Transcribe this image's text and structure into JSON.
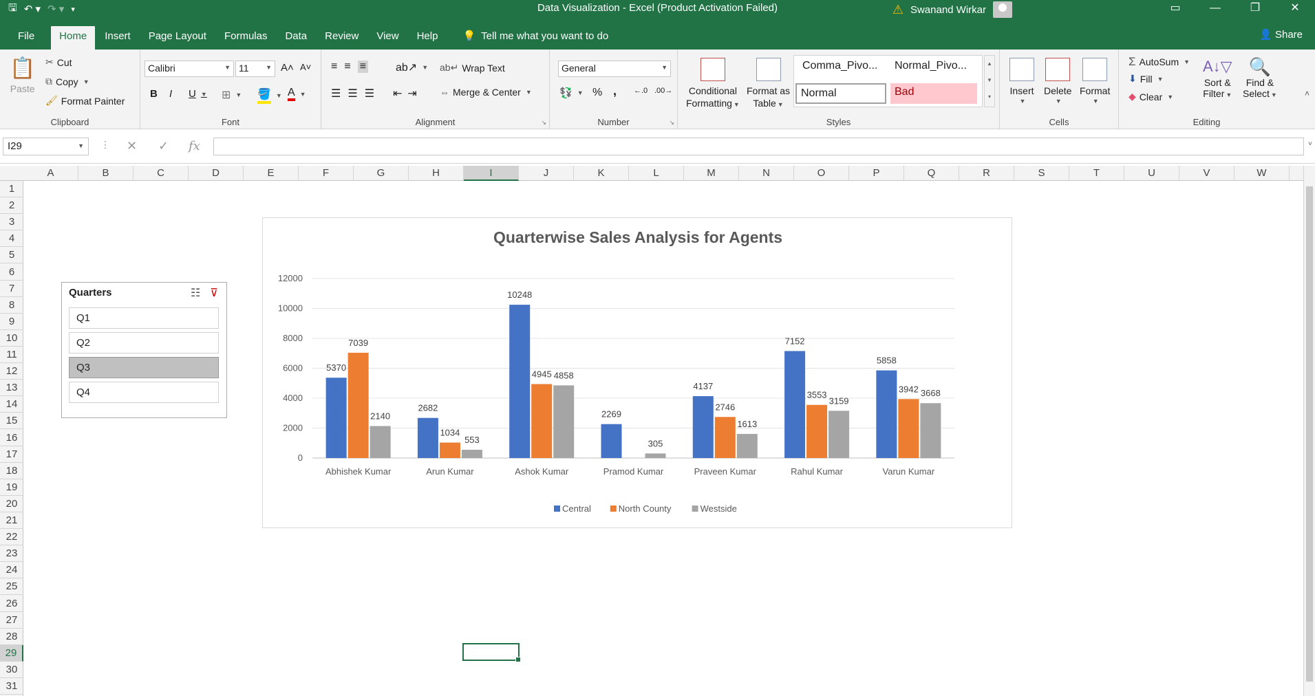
{
  "window": {
    "title": "Data Visualization  -  Excel (Product Activation Failed)",
    "user": "Swanand Wirkar"
  },
  "tabs": {
    "file": "File",
    "home": "Home",
    "insert": "Insert",
    "page_layout": "Page Layout",
    "formulas": "Formulas",
    "data": "Data",
    "review": "Review",
    "view": "View",
    "help": "Help",
    "tell_me": "Tell me what you want to do",
    "share": "Share"
  },
  "clipboard": {
    "paste": "Paste",
    "cut": "Cut",
    "copy": "Copy",
    "format_painter": "Format Painter",
    "label": "Clipboard"
  },
  "font": {
    "name": "Calibri",
    "size": "11",
    "bold": "B",
    "italic": "I",
    "underline": "U",
    "label": "Font"
  },
  "alignment": {
    "wrap_text": "Wrap Text",
    "merge_center": "Merge & Center",
    "label": "Alignment"
  },
  "number": {
    "format": "General",
    "percent": "%",
    "comma": ",",
    "label": "Number"
  },
  "styles": {
    "conditional": "Conditional",
    "conditional2": "Formatting",
    "format_as": "Format as",
    "format_as2": "Table",
    "comma_pivot": "Comma_Pivo...",
    "normal_pivot": "Normal_Pivo...",
    "normal": "Normal",
    "bad": "Bad",
    "label": "Styles"
  },
  "cells": {
    "insert": "Insert",
    "delete": "Delete",
    "format": "Format",
    "label": "Cells"
  },
  "editing": {
    "autosum": "AutoSum",
    "fill": "Fill",
    "clear": "Clear",
    "sort_filter": "Sort &",
    "sort_filter2": "Filter",
    "find_select": "Find &",
    "find_select2": "Select",
    "label": "Editing"
  },
  "formula_bar": {
    "name_box": "I29",
    "fx": "fx",
    "value": ""
  },
  "grid": {
    "columns": [
      "A",
      "B",
      "C",
      "D",
      "E",
      "F",
      "G",
      "H",
      "I",
      "J",
      "K",
      "L",
      "M",
      "N",
      "O",
      "P",
      "Q",
      "R",
      "S",
      "T",
      "U",
      "V",
      "W"
    ],
    "selected_column": "I",
    "rows": [
      "1",
      "2",
      "3",
      "4",
      "5",
      "6",
      "7",
      "8",
      "9",
      "10",
      "11",
      "12",
      "13",
      "14",
      "15",
      "16",
      "17",
      "18",
      "19",
      "20",
      "21",
      "22",
      "23",
      "24",
      "25",
      "26",
      "27",
      "28",
      "29",
      "30",
      "31"
    ],
    "selected_row": "29"
  },
  "slicer": {
    "title": "Quarters",
    "items": [
      "Q1",
      "Q2",
      "Q3",
      "Q4"
    ],
    "selected": "Q3"
  },
  "chart_data": {
    "type": "bar",
    "title": "Quarterwise Sales Analysis for Agents",
    "categories": [
      "Abhishek Kumar",
      "Arun Kumar",
      "Ashok Kumar",
      "Pramod Kumar",
      "Praveen Kumar",
      "Rahul Kumar",
      "Varun Kumar"
    ],
    "series": [
      {
        "name": "Central",
        "color": "#4472c4",
        "values": [
          5370,
          2682,
          10248,
          2269,
          4137,
          7152,
          5858
        ]
      },
      {
        "name": "North County",
        "color": "#ed7d31",
        "values": [
          7039,
          1034,
          4945,
          null,
          2746,
          3553,
          3942
        ]
      },
      {
        "name": "Westside",
        "color": "#a5a5a5",
        "values": [
          2140,
          553,
          4858,
          305,
          1613,
          3159,
          3668
        ]
      }
    ],
    "ylim": [
      0,
      12000
    ],
    "yticks": [
      "0",
      "2000",
      "4000",
      "6000",
      "8000",
      "10000",
      "12000"
    ],
    "grid": true,
    "legend": "bottom"
  }
}
